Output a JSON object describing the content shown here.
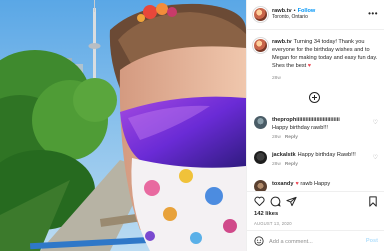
{
  "post": {
    "username": "rawb.tv",
    "follow_label": "Follow",
    "location": "Toronto, Ontario",
    "more_label": "•••"
  },
  "caption": {
    "username": "rawb.tv",
    "text": "Turning 34 today! Thank you everyone for the birthday wishes and to Megan for making today and easy fun day. Shes the best",
    "time": "28w"
  },
  "comments": [
    {
      "username": "theprophiiiiiiiiiiiiiiiiiiiiiiiiiiii",
      "text": "Happy birthday rawb!!!",
      "time": "28w",
      "reply_label": "Reply"
    },
    {
      "username": "jackalstk",
      "text": "Happy birthday Rawb!!!",
      "time": "28w",
      "reply_label": "Reply"
    },
    {
      "username": "toxandy",
      "text": "rawb Happy"
    }
  ],
  "actions": {
    "likes": "142 likes",
    "date": "AUGUST 13, 2020",
    "comment_placeholder": "Add a comment...",
    "post_label": "Post"
  },
  "colors": {
    "accent": "#0095f6",
    "heart": "#ed4956",
    "muted": "#8e8e8e",
    "post_disabled": "#b2dffc"
  }
}
